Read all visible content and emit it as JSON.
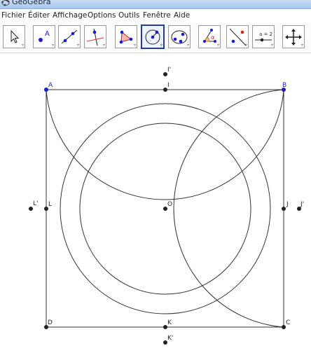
{
  "window": {
    "title": "GeoGebra",
    "icon": "geogebra-app-icon"
  },
  "menu": [
    "Fichier",
    "Éditer",
    "Affichage",
    "Options",
    "Outils",
    "Fenêtre",
    "Aide"
  ],
  "toolbar": {
    "tools": [
      {
        "name": "move-tool",
        "icon": "arrow-cursor-icon",
        "selected": false
      },
      {
        "name": "new-point-tool",
        "icon": "point-a-icon",
        "selected": false
      },
      {
        "name": "line-through-two-points-tool",
        "icon": "line-icon",
        "selected": false
      },
      {
        "name": "perpendicular-line-tool",
        "icon": "perpendicular-icon",
        "selected": false
      },
      {
        "name": "polygon-tool",
        "icon": "polygon-icon",
        "selected": false
      },
      {
        "name": "circle-center-point-tool",
        "icon": "circle-center-point-icon",
        "selected": true
      },
      {
        "name": "conic-through-points-tool",
        "icon": "conic-icon",
        "selected": false
      },
      {
        "name": "angle-tool",
        "icon": "angle-alpha-icon",
        "selected": false
      },
      {
        "name": "reflect-tool",
        "icon": "reflect-icon",
        "selected": false
      },
      {
        "name": "slider-tool",
        "icon": "slider-icon",
        "selected": false
      },
      {
        "name": "move-graphics-view-tool",
        "icon": "move-view-icon",
        "selected": false
      }
    ],
    "slider_icon_label": "a = 2"
  },
  "points": [
    {
      "name": "A",
      "color": "#1a1ad0"
    },
    {
      "name": "B",
      "color": "#1a1ad0"
    },
    {
      "name": "C",
      "color": "#222222"
    },
    {
      "name": "D",
      "color": "#222222"
    },
    {
      "name": "I",
      "color": "#222222"
    },
    {
      "name": "I'",
      "color": "#222222"
    },
    {
      "name": "J",
      "color": "#222222"
    },
    {
      "name": "J'",
      "color": "#222222"
    },
    {
      "name": "K",
      "color": "#222222"
    },
    {
      "name": "K'",
      "color": "#222222"
    },
    {
      "name": "L",
      "color": "#222222"
    },
    {
      "name": "L'",
      "color": "#222222"
    },
    {
      "name": "O",
      "color": "#222222"
    }
  ]
}
